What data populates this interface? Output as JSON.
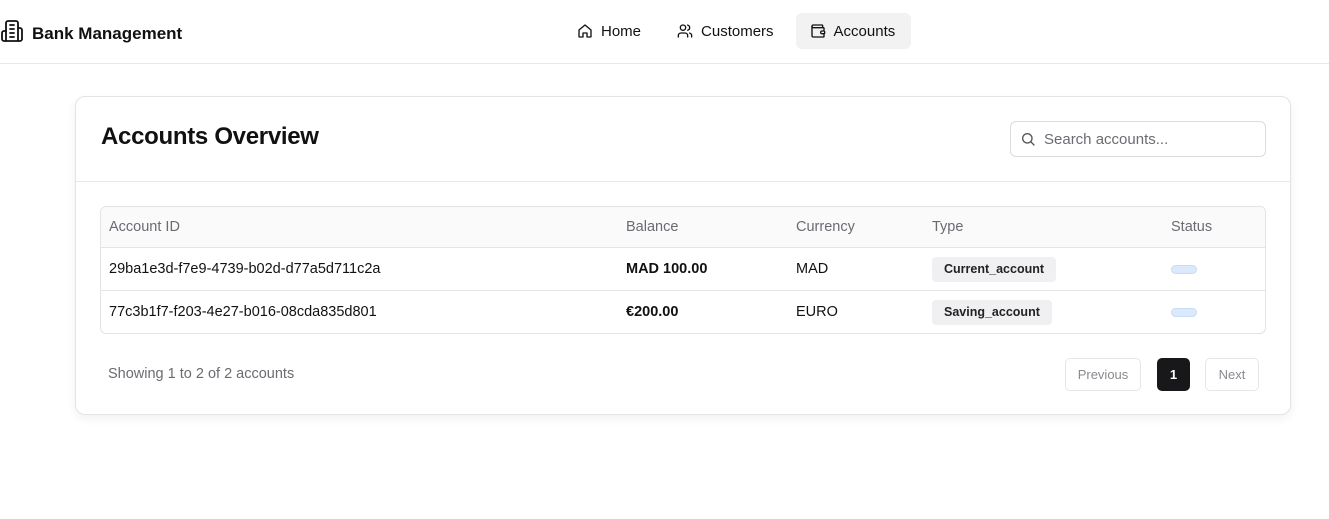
{
  "app": {
    "title": "Bank Management",
    "logo_icon": "building-icon"
  },
  "nav": [
    {
      "label": "Home",
      "icon": "home-icon",
      "active": false
    },
    {
      "label": "Customers",
      "icon": "users-icon",
      "active": false
    },
    {
      "label": "Accounts",
      "icon": "wallet-icon",
      "active": true
    }
  ],
  "page": {
    "title": "Accounts Overview",
    "search_placeholder": "Search accounts..."
  },
  "table": {
    "columns": [
      "Account ID",
      "Balance",
      "Currency",
      "Type",
      "Status"
    ],
    "rows": [
      {
        "id": "29ba1e3d-f7e9-4739-b02d-d77a5d711c2a",
        "balance": "MAD 100.00",
        "currency": "MAD",
        "type": "Current_account",
        "status": ""
      },
      {
        "id": "77c3b1f7-f203-4e27-b016-08cda835d801",
        "balance": "€200.00",
        "currency": "EURO",
        "type": "Saving_account",
        "status": ""
      }
    ]
  },
  "footer": {
    "summary": "Showing 1 to 2 of 2 accounts",
    "prev_label": "Previous",
    "current_page": "1",
    "next_label": "Next"
  },
  "colors": {
    "active_nav_bg": "#f2f2f3",
    "status_badge": "#dbe9fd",
    "current_page_bg": "#18181b"
  }
}
